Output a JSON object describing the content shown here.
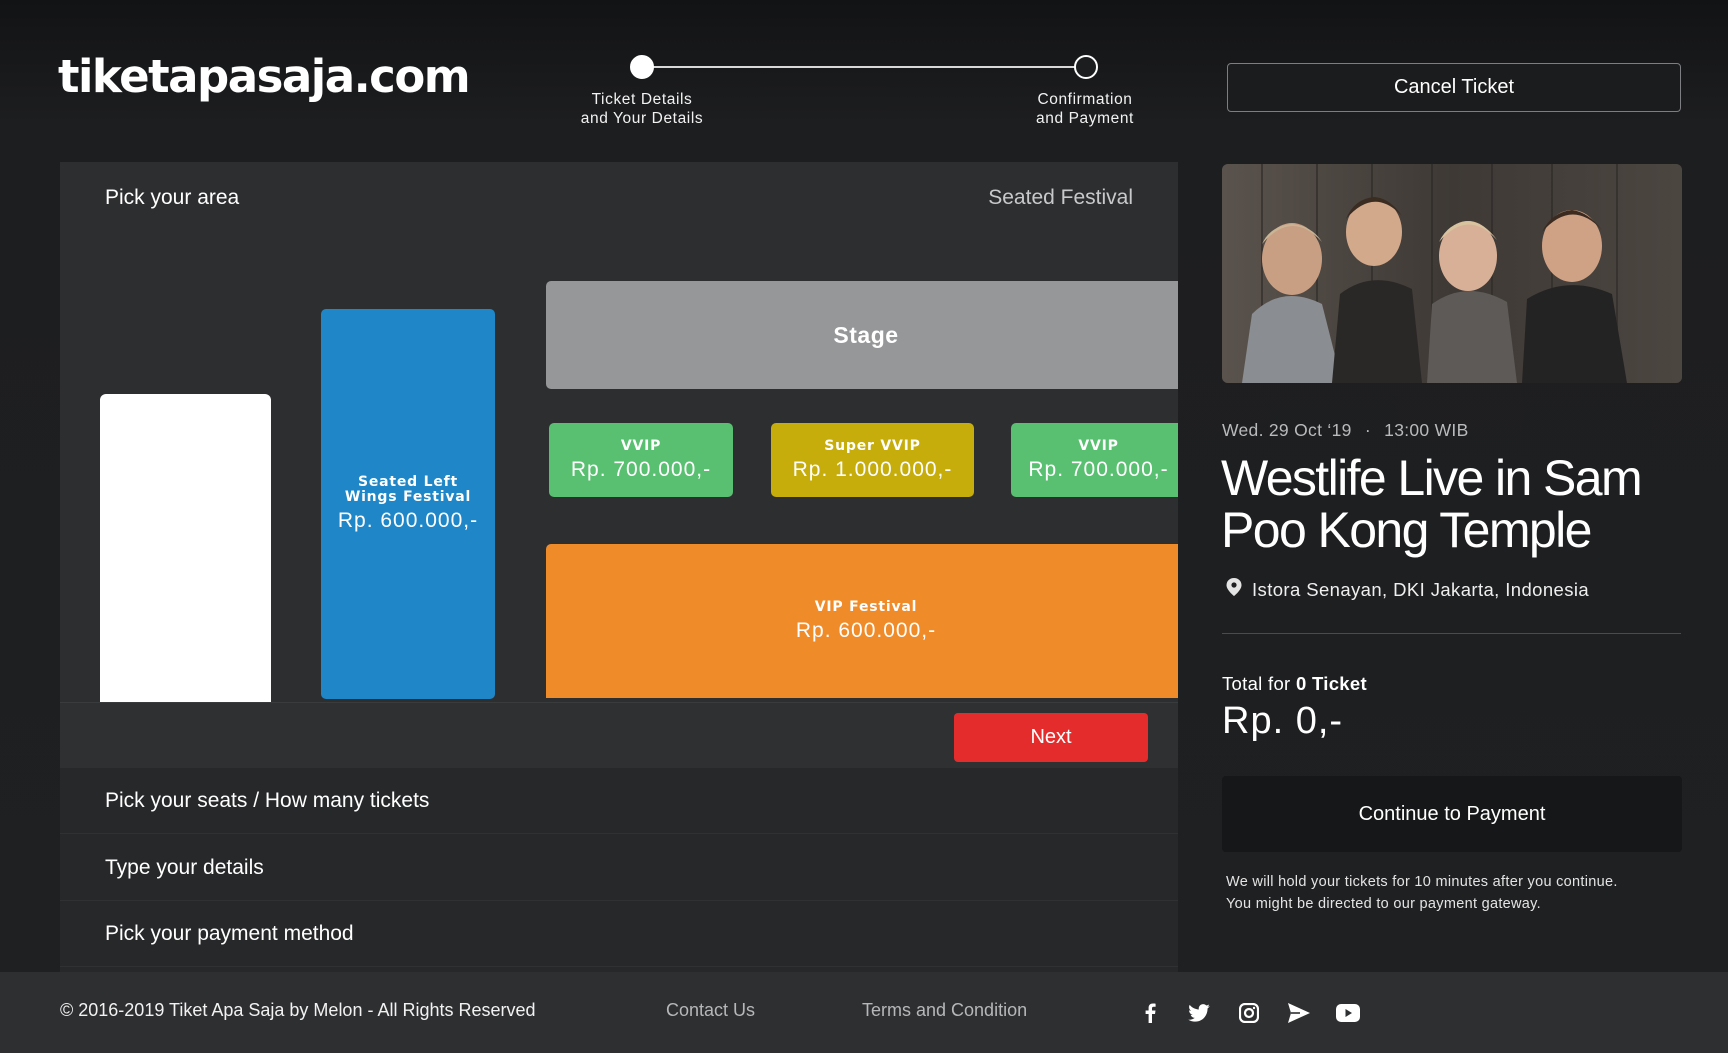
{
  "header": {
    "logo_text": "tiketapasaja.com",
    "steps": [
      {
        "label": "Ticket Details\nand Your Details",
        "state": "done"
      },
      {
        "label": "Confirmation\nand Payment",
        "state": "todo"
      }
    ],
    "cancel_label": "Cancel Ticket"
  },
  "area_picker": {
    "title": "Pick your area",
    "event_type": "Seated Festival",
    "zones": {
      "stage": {
        "name": "Stage",
        "color": "#969799"
      },
      "left_wing": {
        "name": "Seated Left Wings Festival",
        "price": "Rp. 600.000,-",
        "color": "#1f87c8"
      },
      "vvip_left": {
        "name": "VVIP",
        "price": "Rp. 700.000,-",
        "color": "#5ac071"
      },
      "super_vvip": {
        "name": "Super VVIP",
        "price": "Rp. 1.000.000,-",
        "color": "#c6ad0b"
      },
      "vvip_right": {
        "name": "VVIP",
        "price": "Rp. 700.000,-",
        "color": "#5ac071"
      },
      "vip_festival": {
        "name": "VIP Festival",
        "price": "Rp. 600.000,-",
        "color": "#f08b2a"
      }
    },
    "next_label": "Next"
  },
  "accordion": [
    {
      "label": "Pick your seats / How many tickets"
    },
    {
      "label": "Type your details"
    },
    {
      "label": "Pick your payment method"
    }
  ],
  "event": {
    "date": "Wed. 29 Oct ‘19",
    "separator": "·",
    "time": "13:00 WIB",
    "title": "Westlife Live in Sam Poo Kong Temple",
    "venue": "Istora Senayan, DKI Jakarta, Indonesia"
  },
  "summary": {
    "total_prefix": "Total for",
    "ticket_count": "0 Ticket",
    "total_amount": "Rp. 0,-",
    "pay_label": "Continue to Payment",
    "hold_note": "We will hold your tickets for 10 minutes after you continue.\nYou might be directed to our payment gateway."
  },
  "footer": {
    "copyright": "© 2016-2019 Tiket Apa Saja by Melon - All Rights Reserved",
    "links": [
      "Contact Us",
      "Terms and Condition"
    ],
    "social_icons": [
      "facebook-icon",
      "twitter-icon",
      "instagram-icon",
      "send-icon",
      "youtube-icon"
    ]
  },
  "colors": {
    "accent_red": "#e52c2c",
    "background": "#1f2022"
  }
}
